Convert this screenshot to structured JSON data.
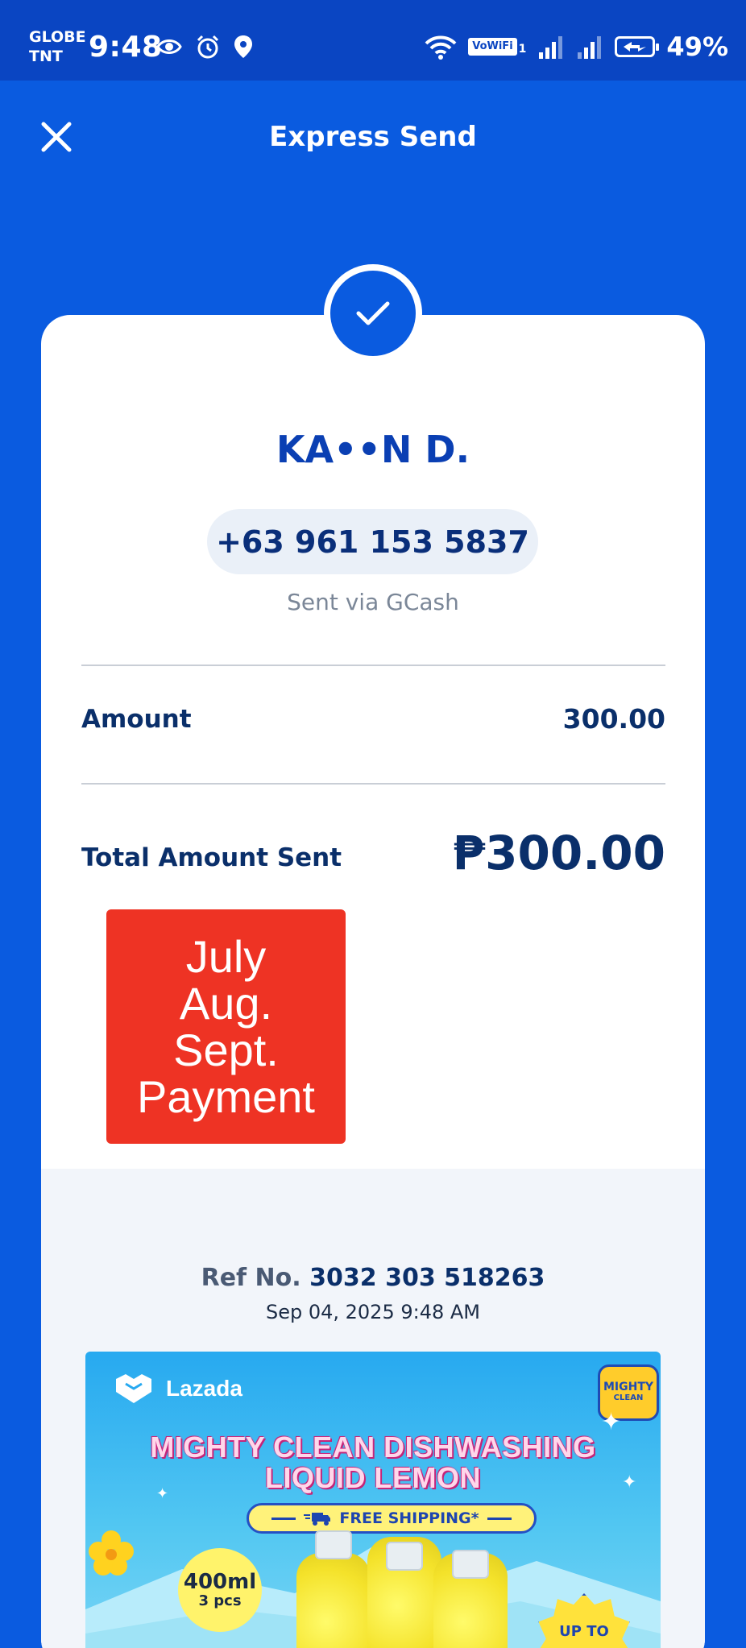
{
  "status_bar": {
    "carrier_line1": "GLOBE",
    "carrier_line2": "TNT",
    "time": "9:48",
    "vowifi": "VoWiFi",
    "sim_index": "1",
    "battery": "49%",
    "icons": [
      "eye-icon",
      "alarm-icon",
      "location-icon",
      "wifi-icon",
      "signal-icon",
      "signal-icon-2",
      "battery-charging-icon"
    ]
  },
  "header": {
    "title": "Express Send",
    "close_icon": "close-icon"
  },
  "receipt": {
    "recipient_name": "KA••N D.",
    "phone": "+63 961 153 5837",
    "sent_via": "Sent via GCash",
    "amount_label": "Amount",
    "amount_value": "300.00",
    "total_label": "Total Amount Sent",
    "total_value": "₱300.00",
    "note_lines": [
      "July",
      "Aug.",
      "Sept.",
      "Payment"
    ]
  },
  "reference": {
    "label": "Ref No.",
    "number": "3032 303 518263",
    "datetime": "Sep 04, 2025 9:48 AM"
  },
  "ad": {
    "brand": "Lazada",
    "partner_badge_line1": "MIGHTY",
    "partner_badge_line2": "CLEAN",
    "headline_line1": "MIGHTY CLEAN DISHWASHING",
    "headline_line2": "LIQUID LEMON",
    "shipping": "FREE SHIPPING*",
    "size": "400ml",
    "pieces": "3 pcs",
    "promo": "UP TO"
  },
  "colors": {
    "primary_blue": "#0a5be0",
    "status_bar_blue": "#0a45c2",
    "text_navy": "#0a2f6a",
    "note_red": "#ee3324"
  }
}
